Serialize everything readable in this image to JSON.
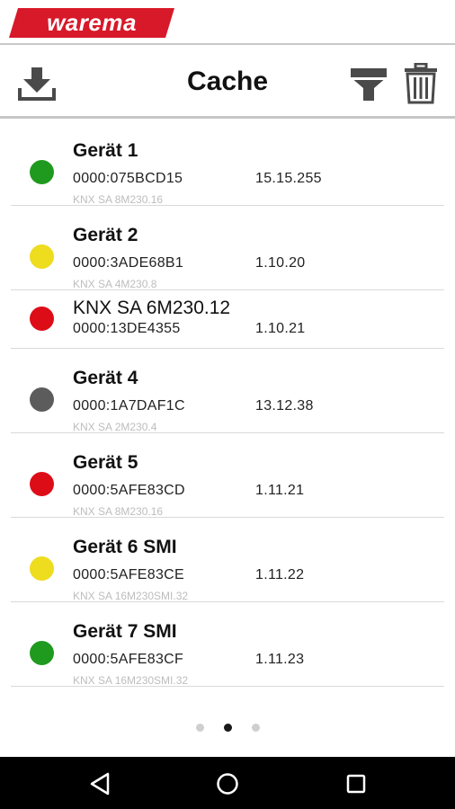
{
  "brand": {
    "logo_text": "warema",
    "color": "#d7192a"
  },
  "toolbar": {
    "title": "Cache",
    "download_icon": "download-icon",
    "filter_icon": "filter-icon",
    "trash_icon": "trash-icon"
  },
  "status_colors": {
    "green": "#1f9a1f",
    "yellow": "#eedc1e",
    "red": "#dd0d18",
    "gray": "#5c5c5c"
  },
  "devices": [
    {
      "name": "Gerät 1",
      "address": "0000:075BCD15",
      "version": "15.15.255",
      "type": "KNX SA 8M230.16",
      "status": "green"
    },
    {
      "name": "Gerät 2",
      "address": "0000:3ADE68B1",
      "version": "1.10.20",
      "type": "KNX SA 4M230.8",
      "status": "yellow"
    },
    {
      "name": "KNX SA 6M230.12",
      "address": "0000:13DE4355",
      "version": "1.10.21",
      "type": "",
      "status": "red"
    },
    {
      "name": "Gerät 4",
      "address": "0000:1A7DAF1C",
      "version": "13.12.38",
      "type": "KNX SA 2M230.4",
      "status": "gray"
    },
    {
      "name": "Gerät 5",
      "address": "0000:5AFE83CD",
      "version": "1.11.21",
      "type": "KNX SA 8M230.16",
      "status": "red"
    },
    {
      "name": "Gerät 6 SMI",
      "address": "0000:5AFE83CE",
      "version": "1.11.22",
      "type": "KNX SA 16M230SMI.32",
      "status": "yellow"
    },
    {
      "name": "Gerät 7 SMI",
      "address": "0000:5AFE83CF",
      "version": "1.11.23",
      "type": "KNX SA 16M230SMI.32",
      "status": "green"
    }
  ],
  "pager": {
    "pages": 3,
    "active": 2
  },
  "navbar": {
    "back_icon": "back-icon",
    "home_icon": "home-icon",
    "recent_icon": "recent-apps-icon"
  }
}
